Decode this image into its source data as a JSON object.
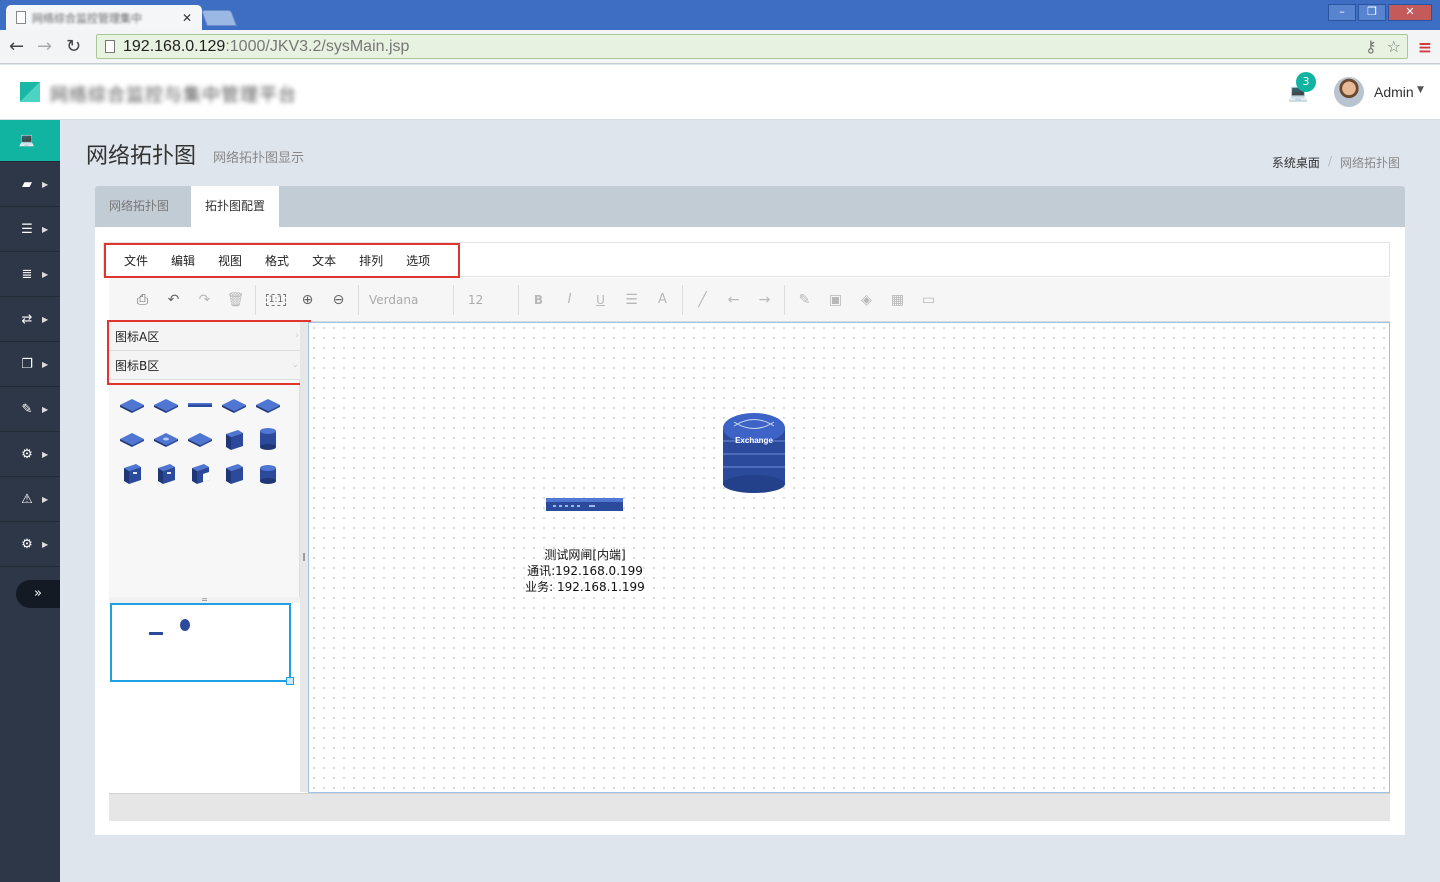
{
  "browser": {
    "tab_title": "网络综合监控管理集中",
    "url_host": "192.168.0.129",
    "url_rest": ":1000/JKV3.2/sysMain.jsp"
  },
  "header": {
    "app_title": "网络综合监控与集中管理平台",
    "notification_count": "3",
    "user_name": "Admin"
  },
  "sidebar": {
    "items": [
      {
        "icon": "laptop-icon",
        "glyph": "💻",
        "active": true
      },
      {
        "icon": "briefcase-icon",
        "glyph": "▰"
      },
      {
        "icon": "sliders-icon",
        "glyph": "☰"
      },
      {
        "icon": "database-icon",
        "glyph": "≣"
      },
      {
        "icon": "exchange-icon",
        "glyph": "⇄"
      },
      {
        "icon": "clipboard-icon",
        "glyph": "❐"
      },
      {
        "icon": "edit-icon",
        "glyph": "✎"
      },
      {
        "icon": "cogs-icon",
        "glyph": "⚙"
      },
      {
        "icon": "warning-icon",
        "glyph": "⚠"
      },
      {
        "icon": "gear-icon",
        "glyph": "⚙"
      }
    ],
    "collapse_glyph": "»"
  },
  "page": {
    "title": "网络拓扑图",
    "subtitle": "网络拓扑图显示",
    "breadcrumb_home": "系统桌面",
    "breadcrumb_sep": "/",
    "breadcrumb_current": "网络拓扑图"
  },
  "tabs": [
    {
      "label": "网络拓扑图",
      "active": false
    },
    {
      "label": "拓扑图配置",
      "active": true
    }
  ],
  "menu": [
    "文件",
    "编辑",
    "视图",
    "格式",
    "文本",
    "排列",
    "选项"
  ],
  "toolbar": {
    "font_name": "Verdana",
    "font_size": "12",
    "zoom_actual_label": "1:1",
    "bold": "B",
    "italic": "I",
    "underline": "U",
    "font_color": "A"
  },
  "palette": {
    "groups": [
      {
        "label": "图标A区",
        "arrow": "›"
      },
      {
        "label": "图标B区",
        "arrow": "⌄"
      }
    ],
    "grip_h": "=",
    "grip_v": "‖"
  },
  "diagram": {
    "server_text": "Exchange",
    "gateway_label": {
      "name": "测试网闸[内端]",
      "comm": "通讯:192.168.0.199",
      "biz": "业务: 192.168.1.199"
    }
  },
  "colors": {
    "accent": "#11b3a1",
    "sidebar_bg": "#2d3748",
    "highlight_border": "#e0342f",
    "device_blue": "#2c4a9c"
  }
}
